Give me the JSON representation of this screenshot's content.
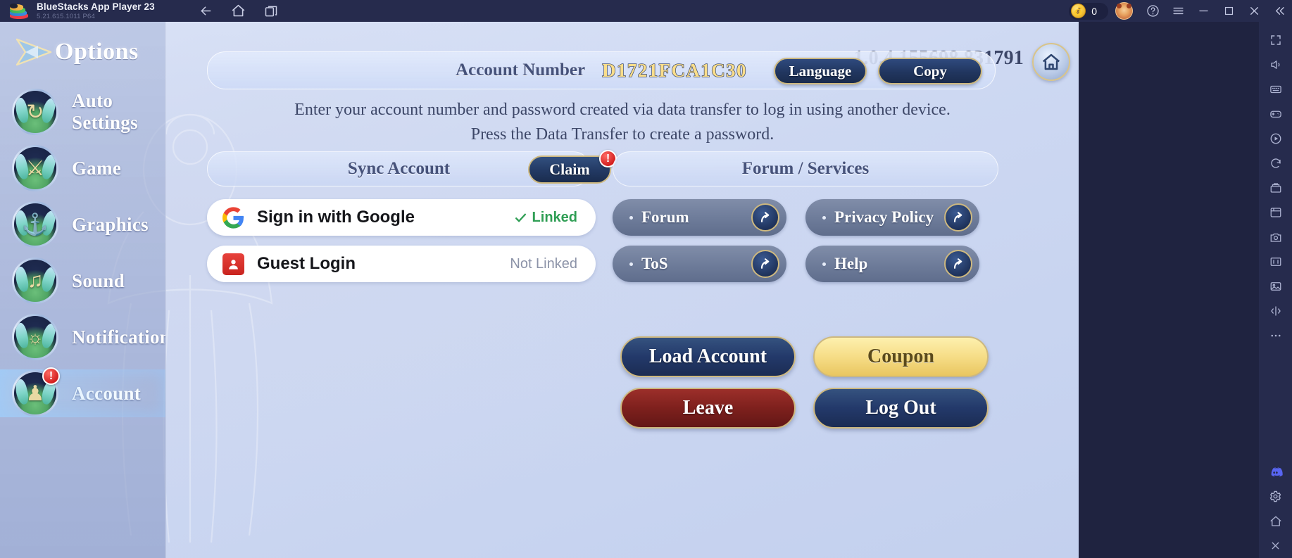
{
  "titlebar": {
    "app_name": "BlueStacks App Player 23",
    "app_version": "5.21.615.1011  P64",
    "nav": [
      {
        "name": "back-icon",
        "label": "Back"
      },
      {
        "name": "home-icon",
        "label": "Home"
      },
      {
        "name": "multi-instance-icon",
        "label": "Multi-instance"
      }
    ],
    "coin_count": "0",
    "controls": [
      {
        "name": "avatar-icon",
        "label": "Profile"
      },
      {
        "name": "help-icon",
        "label": "Help"
      },
      {
        "name": "menu-icon",
        "label": "Menu"
      },
      {
        "name": "minimize-icon",
        "label": "Minimize"
      },
      {
        "name": "maximize-icon",
        "label": "Maximize"
      },
      {
        "name": "close-icon",
        "label": "Close"
      },
      {
        "name": "collapse-icon",
        "label": "Collapse"
      }
    ]
  },
  "sidebar": {
    "header": "Options",
    "items": [
      {
        "label": "Auto Settings",
        "glyph": "↻",
        "badge": "",
        "active": false
      },
      {
        "label": "Game",
        "glyph": "⚔",
        "badge": "",
        "active": false
      },
      {
        "label": "Graphics",
        "glyph": "⚓",
        "badge": "",
        "active": false
      },
      {
        "label": "Sound",
        "glyph": "♫",
        "badge": "",
        "active": false
      },
      {
        "label": "Notification",
        "glyph": "ὑ4",
        "badge": "",
        "active": false
      },
      {
        "label": "Account",
        "glyph": "♟",
        "badge": "!",
        "active": true
      }
    ]
  },
  "content": {
    "version": "1.0.4.155698.831791",
    "home_button": "home-icon",
    "account": {
      "label": "Account Number",
      "value": "D1721FCA1C30",
      "language_button": "Language",
      "copy_button": "Copy"
    },
    "description_line1": "Enter your account number and password created via data transfer to log in using another device.",
    "description_line2": "Press the Data Transfer to create a password.",
    "sync": {
      "title": "Sync Account",
      "claim_button": "Claim",
      "claim_badge": "!"
    },
    "logins": [
      {
        "name": "Sign in with Google",
        "status": "Linked",
        "linked": true,
        "icon": "google-icon"
      },
      {
        "name": "Guest Login",
        "status": "Not Linked",
        "linked": false,
        "icon": "guest-icon"
      }
    ],
    "services": {
      "title": "Forum / Services",
      "buttons": [
        {
          "label": "Forum"
        },
        {
          "label": "Privacy Policy"
        },
        {
          "label": "ToS"
        },
        {
          "label": "Help"
        }
      ]
    },
    "actions": [
      {
        "label": "Load Account",
        "style": "blue"
      },
      {
        "label": "Coupon",
        "style": "gold"
      },
      {
        "label": "Leave",
        "style": "red"
      },
      {
        "label": "Log Out",
        "style": "blue"
      }
    ]
  },
  "rail": {
    "items": [
      {
        "name": "fullscreen-icon"
      },
      {
        "name": "volume-icon"
      },
      {
        "name": "keymap-icon"
      },
      {
        "name": "gamepad-icon"
      },
      {
        "name": "macro-record-icon"
      },
      {
        "name": "rotate-icon"
      },
      {
        "name": "multi-instance-manager-icon"
      },
      {
        "name": "screenshot-icon"
      },
      {
        "name": "camera-icon"
      },
      {
        "name": "resize-icon"
      },
      {
        "name": "media-manager-icon"
      },
      {
        "name": "shake-icon"
      },
      {
        "name": "more-icon"
      },
      {
        "name": "discord-icon"
      },
      {
        "name": "settings-icon"
      },
      {
        "name": "minimize-rail-icon"
      },
      {
        "name": "close-rail-icon"
      }
    ]
  },
  "colors": {
    "titlebar_bg": "#262b4d",
    "accent_gold": "#cdb87f",
    "accent_blue": "#23396a",
    "linked_green": "#2f9e54",
    "badge_red": "#d32020"
  }
}
